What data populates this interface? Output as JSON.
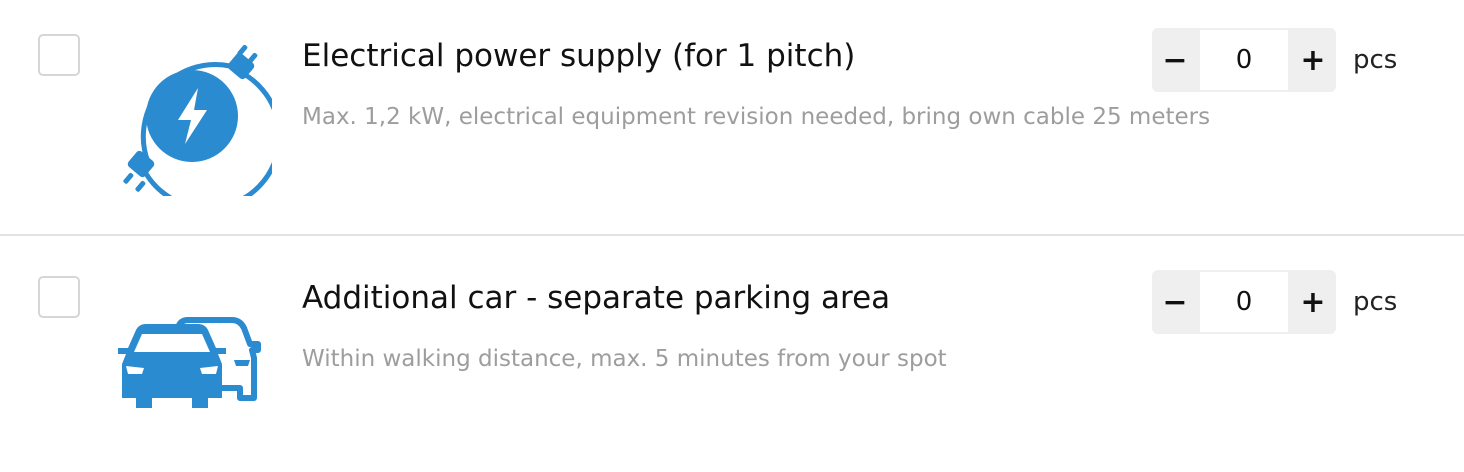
{
  "accent_color": "#2b8bd0",
  "items": [
    {
      "icon": "electric-plug-bolt-icon",
      "title": "Electrical power supply (for 1 pitch)",
      "description": "Max. 1,2 kW, electrical equipment revision needed, bring own cable 25 meters",
      "checked": false,
      "quantity": "0",
      "unit": "pcs",
      "minus_label": "−",
      "plus_label": "+"
    },
    {
      "icon": "two-cars-icon",
      "title": "Additional car - separate parking area",
      "description": "Within walking distance, max. 5 minutes from your spot",
      "checked": false,
      "quantity": "0",
      "unit": "pcs",
      "minus_label": "−",
      "plus_label": "+"
    }
  ]
}
